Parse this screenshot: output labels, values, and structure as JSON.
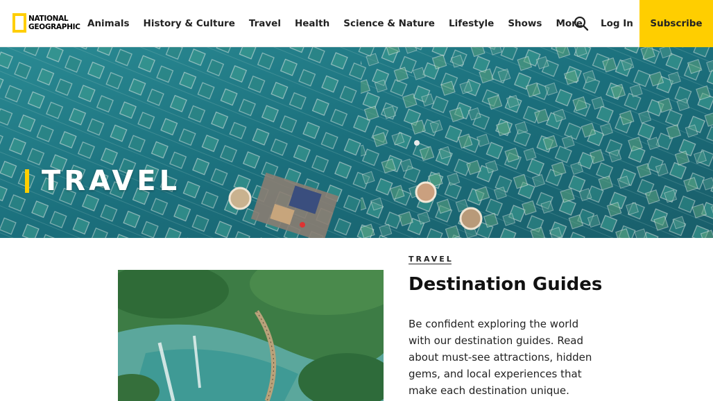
{
  "header": {
    "logo_line1": "NATIONAL",
    "logo_line2": "GEOGRAPHIC",
    "nav": [
      {
        "label": "Animals"
      },
      {
        "label": "History & Culture"
      },
      {
        "label": "Travel"
      },
      {
        "label": "Health"
      },
      {
        "label": "Science & Nature"
      },
      {
        "label": "Lifestyle"
      },
      {
        "label": "Shows"
      },
      {
        "label": "More"
      }
    ],
    "search_icon": "search-icon",
    "login_label": "Log In",
    "subscribe_label": "Subscribe"
  },
  "hero": {
    "title": "TRAVEL"
  },
  "card": {
    "kicker": "TRAVEL",
    "title": "Destination Guides",
    "description": "Be confident exploring the world with our destination guides. Read about must-see attractions, hidden gems, and local experiences that make each destination unique."
  },
  "colors": {
    "accent": "#ffce00",
    "water": "#1d6d78",
    "text": "#222222"
  }
}
